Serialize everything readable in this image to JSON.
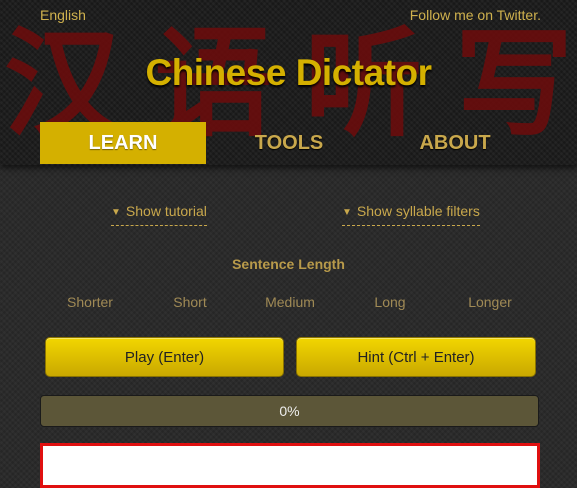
{
  "header": {
    "language_link": "English",
    "twitter_link": "Follow me on Twitter.",
    "title": "Chinese Dictator",
    "watermark_chars": [
      "汉",
      "语",
      "听",
      "写"
    ],
    "accent_color": "#d4b000",
    "watermark_color": "#6e0c0c"
  },
  "nav": {
    "tabs": [
      {
        "label": "LEARN",
        "active": true
      },
      {
        "label": "TOOLS",
        "active": false
      },
      {
        "label": "ABOUT",
        "active": false
      }
    ]
  },
  "toggles": {
    "tutorial": "Show tutorial",
    "filters": "Show syllable filters",
    "caret": "▼"
  },
  "sentence_length": {
    "title": "Sentence Length",
    "options": [
      "Shorter",
      "Short",
      "Medium",
      "Long",
      "Longer"
    ]
  },
  "buttons": {
    "play": "Play (Enter)",
    "hint": "Hint (Ctrl + Enter)"
  },
  "progress": {
    "label": "0%",
    "value": 0
  },
  "answer": {
    "value": "",
    "placeholder": "",
    "border_color": "#e01010"
  }
}
